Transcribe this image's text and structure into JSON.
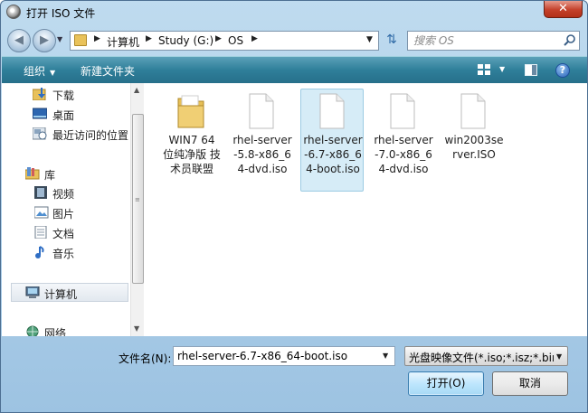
{
  "window": {
    "title": "打开 ISO 文件",
    "close_label": "✕"
  },
  "address": {
    "breadcrumbs": [
      "计算机",
      "Study (G:)",
      "OS"
    ]
  },
  "search": {
    "placeholder": "搜索 OS"
  },
  "toolbar": {
    "organize_label": "组织",
    "new_folder_label": "新建文件夹",
    "help_label": "?"
  },
  "nav": {
    "favorites": [
      {
        "label": "下载",
        "icon": "download-folder-icon"
      },
      {
        "label": "桌面",
        "icon": "desktop-icon"
      },
      {
        "label": "最近访问的位置",
        "icon": "recent-places-icon"
      }
    ],
    "library": {
      "label": "库",
      "icon": "library-icon"
    },
    "library_items": [
      {
        "label": "视频",
        "icon": "video-icon"
      },
      {
        "label": "图片",
        "icon": "pictures-icon"
      },
      {
        "label": "文档",
        "icon": "documents-icon"
      },
      {
        "label": "音乐",
        "icon": "music-icon"
      }
    ],
    "computer": {
      "label": "计算机",
      "icon": "computer-icon"
    },
    "network": {
      "label": "网络",
      "icon": "network-icon"
    }
  },
  "files": [
    {
      "name": "WIN7 64 位纯净版 技术员联盟",
      "type": "folder",
      "selected": false
    },
    {
      "name": "rhel-server-5.8-x86_64-dvd.iso",
      "type": "file",
      "selected": false
    },
    {
      "name": "rhel-server-6.7-x86_64-boot.iso",
      "type": "file",
      "selected": true
    },
    {
      "name": "rhel-server-7.0-x86_64-dvd.iso",
      "type": "file",
      "selected": false
    },
    {
      "name": "win2003server.ISO",
      "type": "file",
      "selected": false
    }
  ],
  "bottom": {
    "filename_label": "文件名(N):",
    "filename_value": "rhel-server-6.7-x86_64-boot.iso",
    "filetype_value": "光盘映像文件(*.iso;*.isz;*.bin;*",
    "open_label": "打开(O)",
    "cancel_label": "取消"
  },
  "colors": {
    "toolbar": "#2f7f9a",
    "selection": "#d6ecf7",
    "close": "#c4402a"
  }
}
